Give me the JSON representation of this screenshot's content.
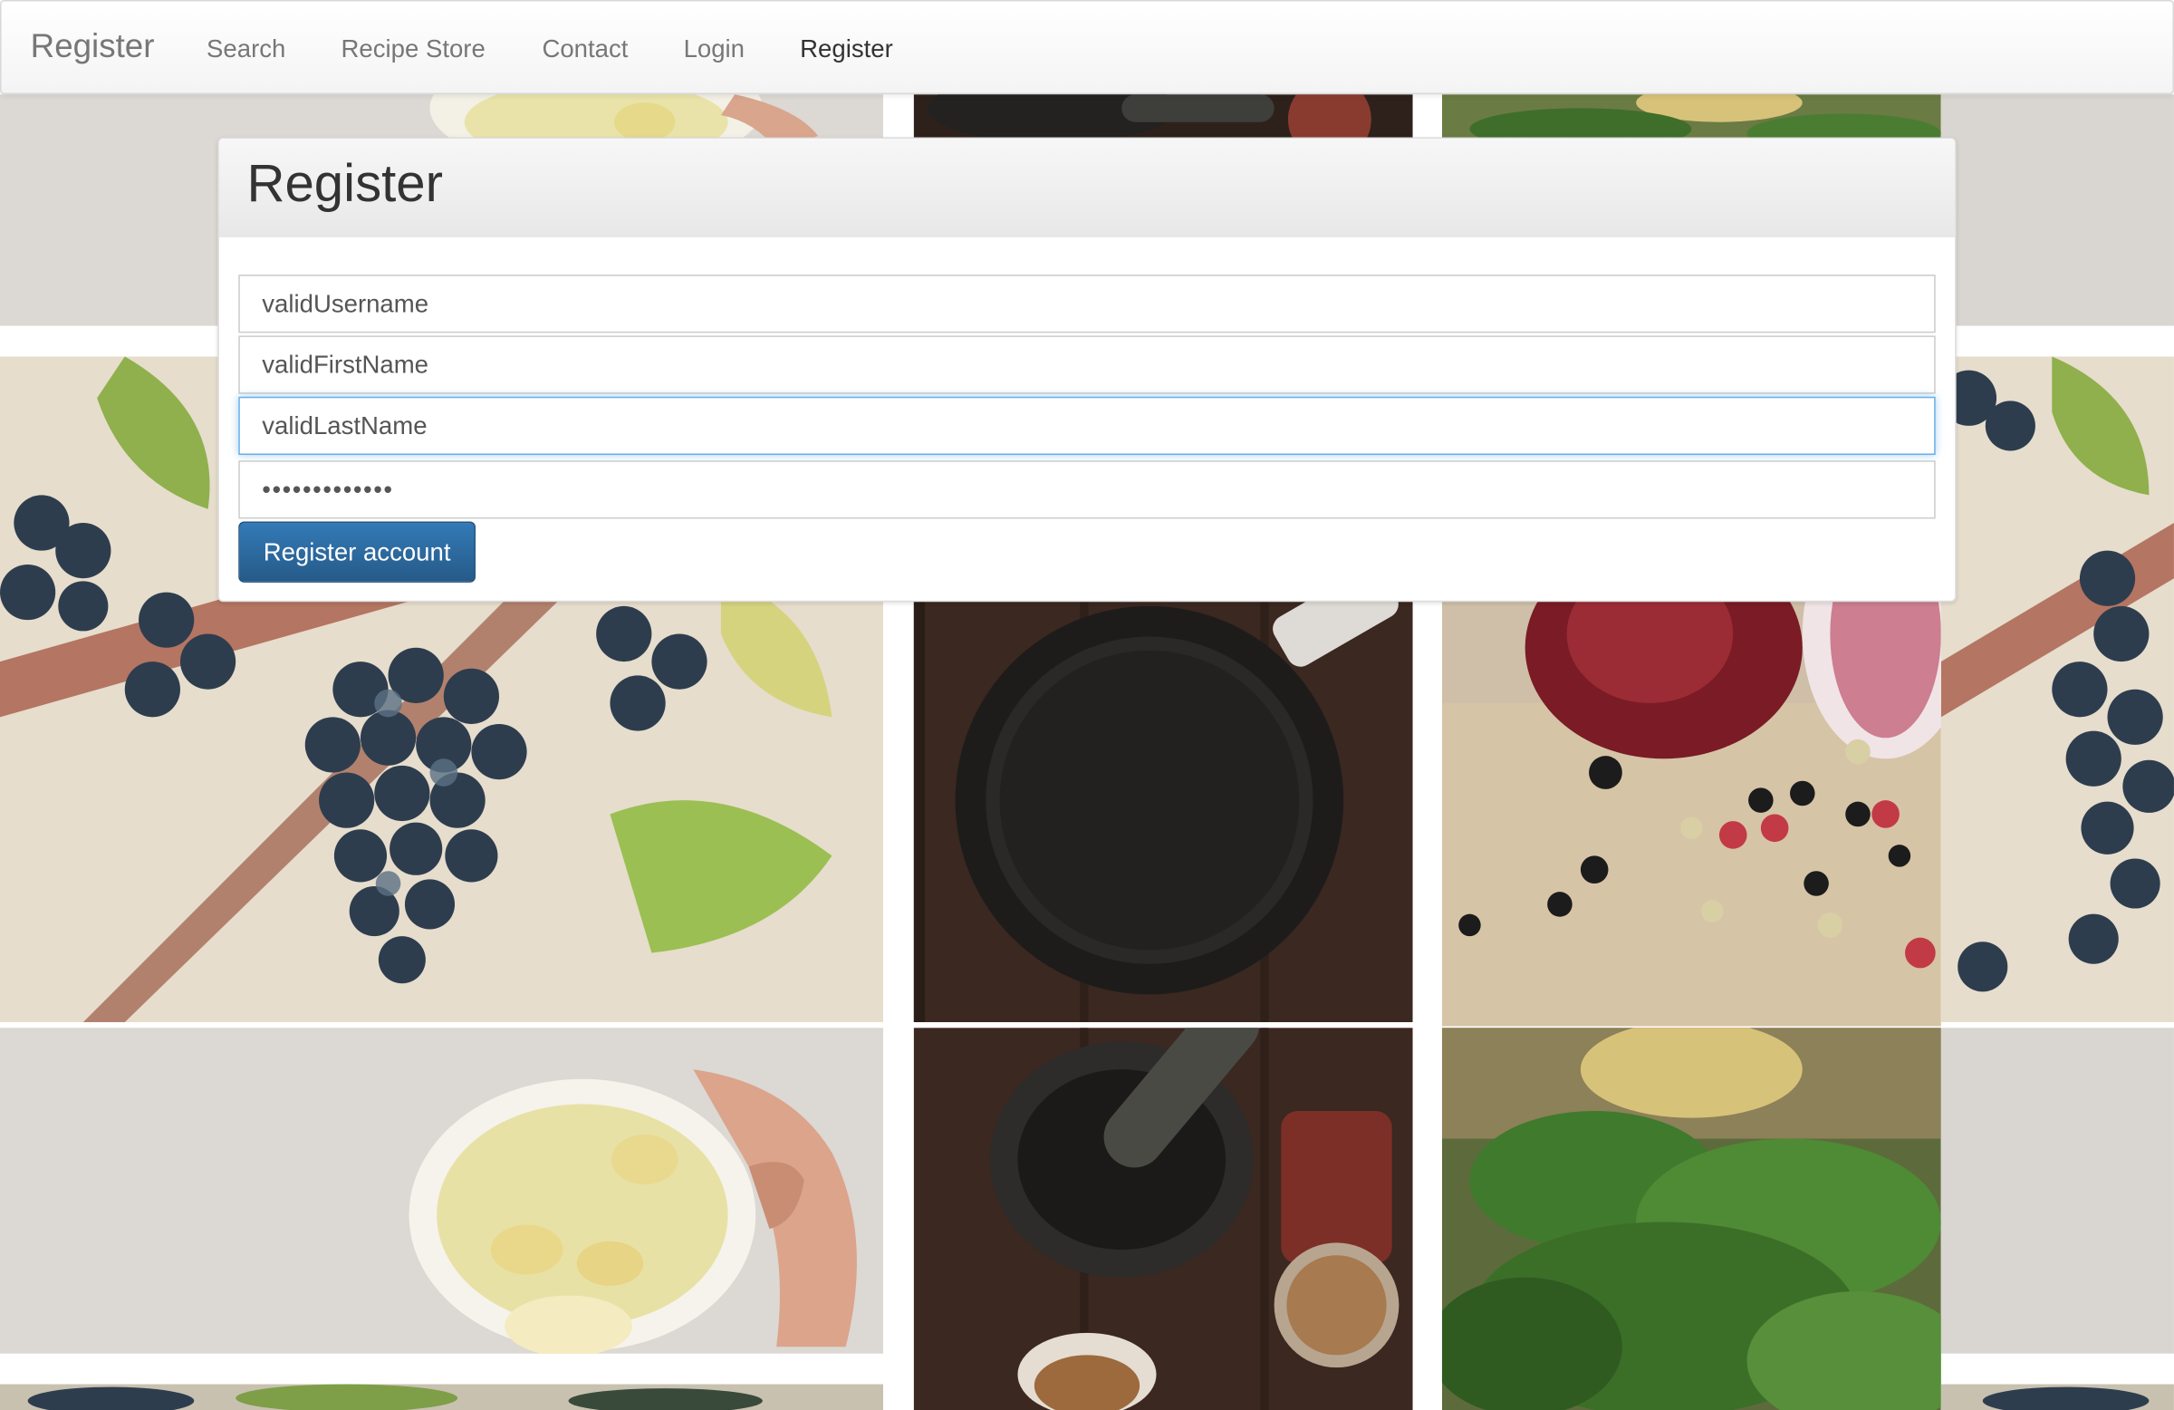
{
  "nav": {
    "brand": "Register",
    "items": [
      {
        "label": "Search"
      },
      {
        "label": "Recipe Store"
      },
      {
        "label": "Contact"
      },
      {
        "label": "Login"
      },
      {
        "label": "Register",
        "active": true
      }
    ]
  },
  "panel": {
    "title": "Register",
    "fields": {
      "username_value": "validUsername",
      "firstname_value": "validFirstName",
      "lastname_value": "validLastName",
      "password_value": "validPassword"
    },
    "submit_label": "Register account"
  },
  "background_tiles": [
    {
      "subject": "grapes"
    },
    {
      "subject": "ginger-tea-bowl"
    },
    {
      "subject": "cast-iron-pan"
    },
    {
      "subject": "mortar-and-pestle"
    },
    {
      "subject": "red-onion-peppercorns"
    },
    {
      "subject": "parsley"
    }
  ],
  "theme": {
    "accent": "#337ab7",
    "focus_border": "#66afe9"
  }
}
